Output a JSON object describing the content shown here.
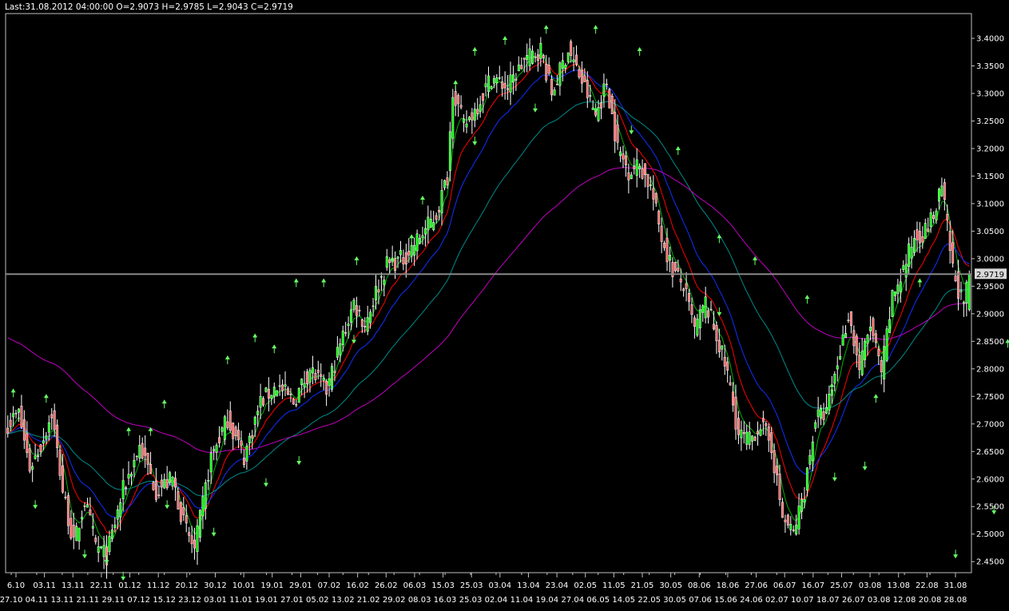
{
  "header": {
    "text": "Last:31.08.2012 04:00:00 O=2.9073 H=2.9785 L=2.9043 C=2.9719"
  },
  "last_price_label": "2.9719",
  "colors": {
    "background": "#000000",
    "frame": "#c0c0c0",
    "axis_text": "#ffffff",
    "up_candle": "#00ff00",
    "down_candle": "#ff6666",
    "wick": "#ffffff",
    "fractal_arrow": "#66ff66",
    "price_line": "#888888",
    "ma_green": "#00b000",
    "ma_red": "#ff0000",
    "ma_blue": "#1030ff",
    "ma_teal": "#008a8a",
    "ma_magenta": "#c000c0"
  },
  "chart_data": {
    "type": "candlestick",
    "title": "",
    "ylim": [
      2.43,
      3.445
    ],
    "y_ticks": [
      "3.4000",
      "3.3500",
      "3.3000",
      "3.2500",
      "3.2000",
      "3.1500",
      "3.1000",
      "3.0500",
      "3.0000",
      "2.9500",
      "2.9000",
      "2.8500",
      "2.8000",
      "2.7500",
      "2.7000",
      "2.6500",
      "2.6000",
      "2.5500",
      "2.5000",
      "2.4500"
    ],
    "x_ticks_top": [
      "6.10",
      "03.11",
      "13.11",
      "22.11",
      "01.12",
      "11.12",
      "20.12",
      "30.12",
      "10.01",
      "19.01",
      "29.01",
      "07.02",
      "16.02",
      "26.02",
      "06.03",
      "15.03",
      "25.03",
      "03.04",
      "13.04",
      "23.04",
      "02.05",
      "11.05",
      "21.05",
      "30.05",
      "08.06",
      "18.06",
      "27.06",
      "06.07",
      "16.07",
      "25.07",
      "03.08",
      "13.08",
      "22.08",
      "31.08"
    ],
    "x_ticks_bottom": [
      "27.10",
      "04.11",
      "13.11",
      "21.11",
      "29.11",
      "07.12",
      "15.12",
      "23.12",
      "03.01",
      "11.01",
      "19.01",
      "27.01",
      "05.02",
      "13.02",
      "21.02",
      "29.02",
      "08.03",
      "16.03",
      "25.03",
      "02.04",
      "11.04",
      "19.04",
      "27.04",
      "06.05",
      "14.05",
      "22.05",
      "30.05",
      "07.06",
      "15.06",
      "24.06",
      "02.07",
      "10.07",
      "18.07",
      "26.07",
      "03.08",
      "12.08",
      "20.08",
      "28.08"
    ],
    "close_path": [
      [
        0,
        2.7
      ],
      [
        4,
        2.72
      ],
      [
        8,
        2.62
      ],
      [
        12,
        2.66
      ],
      [
        16,
        2.72
      ],
      [
        20,
        2.58
      ],
      [
        24,
        2.48
      ],
      [
        28,
        2.56
      ],
      [
        32,
        2.48
      ],
      [
        36,
        2.46
      ],
      [
        42,
        2.58
      ],
      [
        48,
        2.66
      ],
      [
        54,
        2.58
      ],
      [
        60,
        2.6
      ],
      [
        64,
        2.52
      ],
      [
        68,
        2.47
      ],
      [
        74,
        2.64
      ],
      [
        80,
        2.71
      ],
      [
        86,
        2.64
      ],
      [
        92,
        2.74
      ],
      [
        98,
        2.77
      ],
      [
        104,
        2.74
      ],
      [
        110,
        2.8
      ],
      [
        116,
        2.76
      ],
      [
        122,
        2.86
      ],
      [
        126,
        2.92
      ],
      [
        130,
        2.88
      ],
      [
        134,
        2.94
      ],
      [
        138,
        2.99
      ],
      [
        144,
        3.0
      ],
      [
        150,
        3.04
      ],
      [
        156,
        3.08
      ],
      [
        160,
        3.15
      ],
      [
        162,
        3.31
      ],
      [
        166,
        3.24
      ],
      [
        170,
        3.27
      ],
      [
        176,
        3.33
      ],
      [
        182,
        3.31
      ],
      [
        188,
        3.36
      ],
      [
        194,
        3.38
      ],
      [
        198,
        3.3
      ],
      [
        204,
        3.38
      ],
      [
        210,
        3.31
      ],
      [
        214,
        3.26
      ],
      [
        218,
        3.32
      ],
      [
        222,
        3.2
      ],
      [
        226,
        3.16
      ],
      [
        230,
        3.17
      ],
      [
        234,
        3.13
      ],
      [
        238,
        3.04
      ],
      [
        242,
        2.98
      ],
      [
        246,
        2.95
      ],
      [
        250,
        2.87
      ],
      [
        254,
        2.92
      ],
      [
        258,
        2.86
      ],
      [
        262,
        2.79
      ],
      [
        266,
        2.68
      ],
      [
        270,
        2.67
      ],
      [
        274,
        2.7
      ],
      [
        278,
        2.66
      ],
      [
        282,
        2.53
      ],
      [
        286,
        2.5
      ],
      [
        290,
        2.58
      ],
      [
        294,
        2.71
      ],
      [
        298,
        2.72
      ],
      [
        302,
        2.81
      ],
      [
        306,
        2.9
      ],
      [
        310,
        2.8
      ],
      [
        314,
        2.88
      ],
      [
        318,
        2.79
      ],
      [
        322,
        2.93
      ],
      [
        326,
        2.98
      ],
      [
        330,
        3.04
      ],
      [
        334,
        3.05
      ],
      [
        338,
        3.09
      ],
      [
        340,
        3.13
      ],
      [
        344,
        2.98
      ],
      [
        348,
        2.91
      ],
      [
        350,
        2.97
      ]
    ],
    "fractal_highs": [
      [
        2,
        2.76
      ],
      [
        14,
        2.75
      ],
      [
        44,
        2.69
      ],
      [
        52,
        2.69
      ],
      [
        57,
        2.74
      ],
      [
        80,
        2.82
      ],
      [
        90,
        2.86
      ],
      [
        97,
        2.84
      ],
      [
        105,
        2.96
      ],
      [
        115,
        2.96
      ],
      [
        127,
        3.0
      ],
      [
        140,
        3.0
      ],
      [
        147,
        3.04
      ],
      [
        151,
        3.11
      ],
      [
        163,
        3.32
      ],
      [
        170,
        3.38
      ],
      [
        181,
        3.4
      ],
      [
        196,
        3.42
      ],
      [
        214,
        3.42
      ],
      [
        230,
        3.38
      ],
      [
        244,
        3.2
      ],
      [
        259,
        3.04
      ],
      [
        272,
        3.0
      ],
      [
        291,
        2.93
      ],
      [
        300,
        2.77
      ],
      [
        316,
        2.75
      ],
      [
        332,
        2.96
      ],
      [
        364,
        2.85
      ],
      [
        379,
        2.91
      ],
      [
        381,
        2.93
      ],
      [
        413,
        3.06
      ],
      [
        436,
        3.15
      ]
    ],
    "fractal_lows": [
      [
        10,
        2.55
      ],
      [
        28,
        2.46
      ],
      [
        36,
        2.45
      ],
      [
        42,
        2.42
      ],
      [
        58,
        2.55
      ],
      [
        75,
        2.5
      ],
      [
        94,
        2.59
      ],
      [
        106,
        2.63
      ],
      [
        126,
        2.85
      ],
      [
        170,
        3.21
      ],
      [
        192,
        3.27
      ],
      [
        214,
        3.27
      ],
      [
        227,
        3.23
      ],
      [
        259,
        2.9
      ],
      [
        301,
        2.6
      ],
      [
        312,
        2.62
      ],
      [
        345,
        2.46
      ],
      [
        359,
        2.54
      ],
      [
        379,
        2.75
      ],
      [
        410,
        2.78
      ],
      [
        424,
        2.87
      ],
      [
        440,
        2.89
      ]
    ],
    "moving_averages": [
      {
        "key": "ma_green",
        "period": 5,
        "color": "#00b000"
      },
      {
        "key": "ma_red",
        "period": 12,
        "color": "#ff0000"
      },
      {
        "key": "ma_blue",
        "period": 22,
        "color": "#1030ff"
      },
      {
        "key": "ma_teal",
        "period": 50,
        "color": "#008a8a"
      },
      {
        "key": "ma_magenta",
        "period": 110,
        "color": "#c000c0",
        "seed_start": 2.86
      }
    ],
    "last": {
      "date": "31.08.2012 04:00:00",
      "open": 2.9073,
      "high": 2.9785,
      "low": 2.9043,
      "close": 2.9719
    },
    "grid": false,
    "legend": "none"
  }
}
